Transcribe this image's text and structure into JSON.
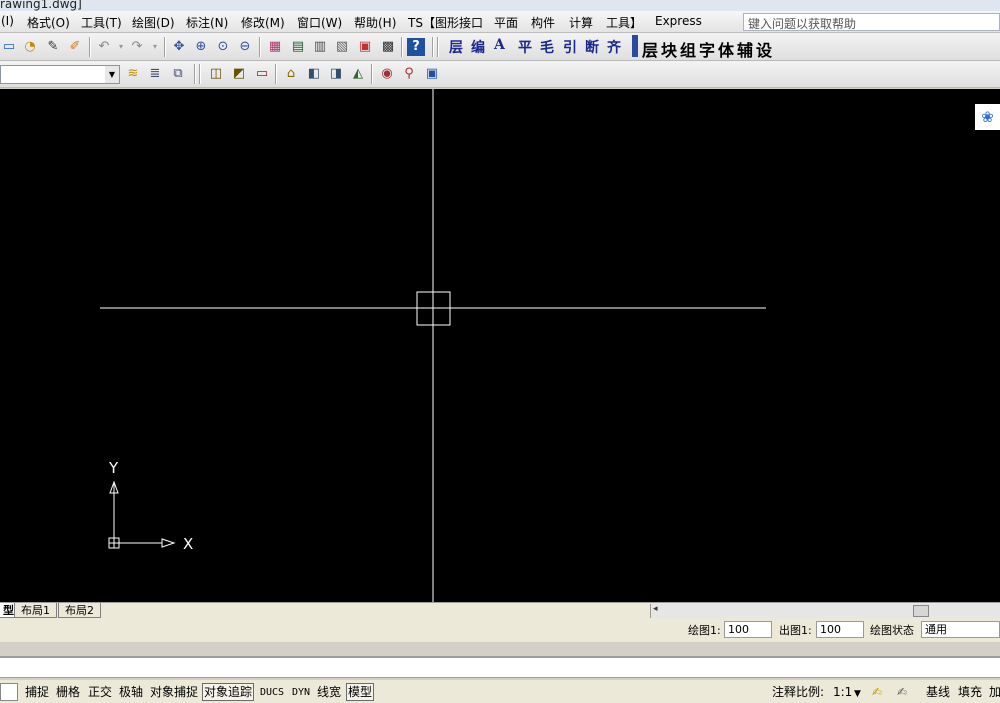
{
  "window": {
    "title": "rawing1.dwg]"
  },
  "menu": {
    "items": [
      "(I)",
      "格式(O)",
      "工具(T)",
      "绘图(D)",
      "标注(N)",
      "修改(M)",
      "窗口(W)",
      "帮助(H)",
      "TS【图形接口",
      "平面",
      "构件",
      "计算",
      "工具】",
      "Express"
    ],
    "help_placeholder": "键入问题以获取帮助"
  },
  "toolbar_ts": {
    "buttons": [
      "层",
      "编",
      "A",
      "平",
      "毛",
      "引",
      "断",
      "齐"
    ],
    "tools_label": "层块组字体辅设"
  },
  "canvas": {
    "background": "#000000",
    "crosshair_color": "#ffffff",
    "ucs": {
      "y_label": "Y",
      "x_label": "X"
    }
  },
  "tabs": [
    "型",
    "布局1",
    "布局2"
  ],
  "scale_bar": {
    "draw_label": "绘图1:",
    "draw_value": "100",
    "out_label": "出图1:",
    "out_value": "100",
    "state_label": "绘图状态",
    "state_value": "通用"
  },
  "status": {
    "left": [
      "捕捉",
      "栅格",
      "正交",
      "极轴",
      "对象捕捉",
      "对象追踪",
      "DUCS",
      "DYN",
      "线宽",
      "模型"
    ],
    "active": [
      "对象追踪",
      "模型"
    ],
    "annotation_scale_label": "注释比例:",
    "annotation_scale_value": "1:1",
    "right": [
      "基线",
      "填充",
      "加"
    ]
  },
  "icons": {
    "paw": "paw-icon"
  }
}
